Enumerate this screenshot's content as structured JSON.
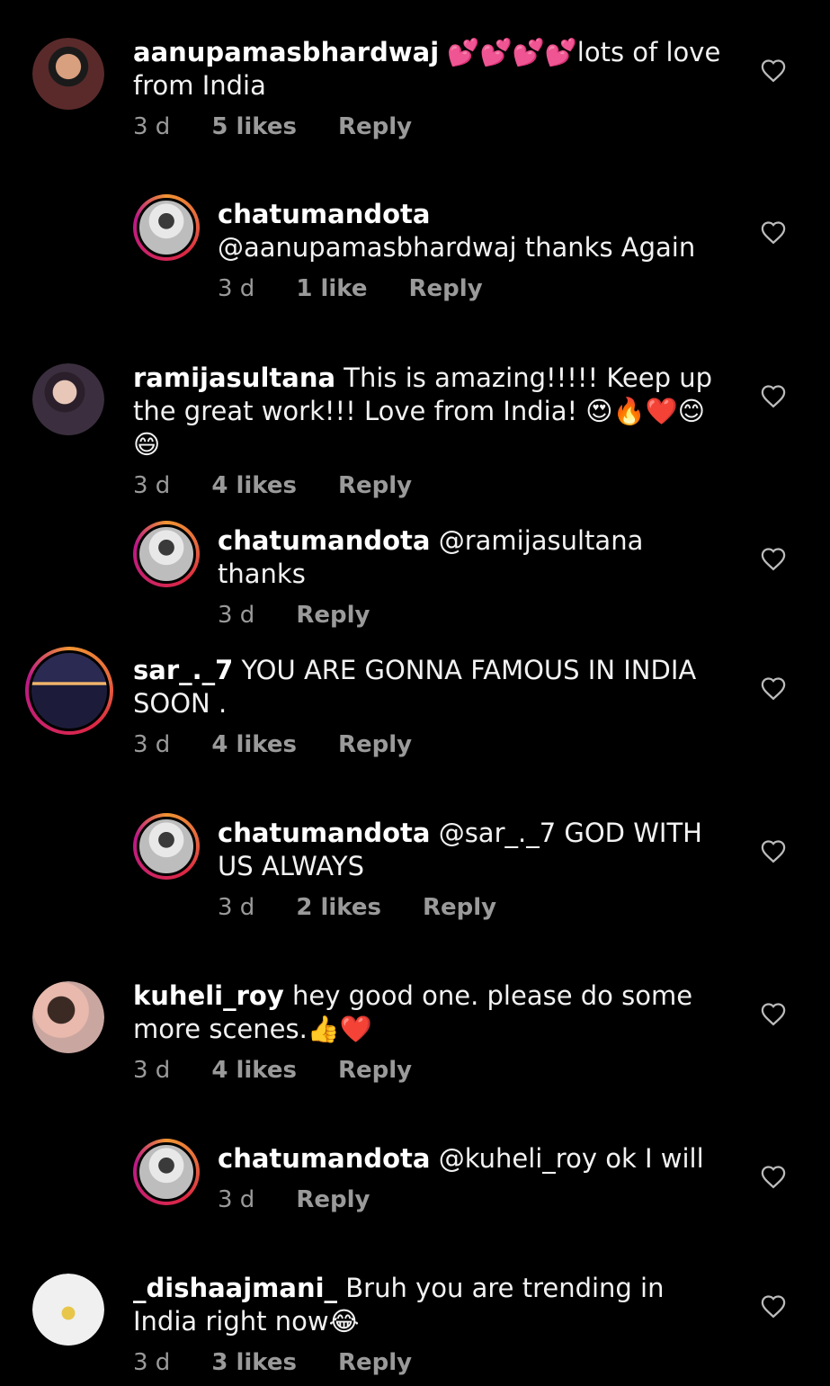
{
  "comments": [
    {
      "username": "aanupamasbhardwaj",
      "text": "💕💕💕💕lots of love from India",
      "time": "3 d",
      "likes": "5 likes",
      "reply": "Reply",
      "is_reply": false,
      "avatar": {
        "bg": "#5a2a2a",
        "accent": "#d9a080",
        "ring": false
      }
    },
    {
      "username": "chatumandota",
      "text": "@aanupamasbhardwaj thanks Again",
      "time": "3 d",
      "likes": "1 like",
      "reply": "Reply",
      "is_reply": true,
      "avatar": {
        "bg": "#dcdcdc",
        "accent": "#3a3a3a",
        "ring": true
      }
    },
    {
      "username": "ramijasultana",
      "text": "This is amazing!!!!! Keep up the great work!!! Love from India! 😍🔥❤️😊😄",
      "time": "3 d",
      "likes": "4 likes",
      "reply": "Reply",
      "is_reply": false,
      "avatar": {
        "bg": "#3b2f3f",
        "accent": "#e8c7b8",
        "ring": false
      }
    },
    {
      "username": "chatumandota",
      "text": "@ramijasultana thanks",
      "time": "3 d",
      "likes": "",
      "reply": "Reply",
      "is_reply": true,
      "avatar": {
        "bg": "#dcdcdc",
        "accent": "#3a3a3a",
        "ring": true
      }
    },
    {
      "username": "sar_._7",
      "text": "YOU ARE GONNA FAMOUS IN INDIA SOON .",
      "time": "3 d",
      "likes": "4 likes",
      "reply": "Reply",
      "is_reply": false,
      "avatar": {
        "bg": "#1c1c3a",
        "accent": "#f2b66b",
        "ring": true
      }
    },
    {
      "username": "chatumandota",
      "text": "@sar_._7 GOD WITH US ALWAYS",
      "time": "3 d",
      "likes": "2 likes",
      "reply": "Reply",
      "is_reply": true,
      "avatar": {
        "bg": "#dcdcdc",
        "accent": "#3a3a3a",
        "ring": true
      }
    },
    {
      "username": "kuheli_roy",
      "text": "hey good one. please do some more scenes.👍❤️",
      "time": "3 d",
      "likes": "4 likes",
      "reply": "Reply",
      "is_reply": false,
      "avatar": {
        "bg": "#c9a6a0",
        "accent": "#3b2a24",
        "ring": false
      }
    },
    {
      "username": "chatumandota",
      "text": "@kuheli_roy ok I will",
      "time": "3 d",
      "likes": "",
      "reply": "Reply",
      "is_reply": true,
      "avatar": {
        "bg": "#dcdcdc",
        "accent": "#3a3a3a",
        "ring": true
      }
    },
    {
      "username": "_dishaajmani_",
      "text": "Bruh you are trending in India right now😂",
      "time": "3 d",
      "likes": "3 likes",
      "reply": "Reply",
      "is_reply": false,
      "avatar": {
        "bg": "#f0f0f0",
        "accent": "#e7c64a",
        "ring": false
      }
    }
  ],
  "icons": {
    "like": "heart-outline-icon"
  },
  "colors": {
    "background": "#000000",
    "meta": "#9a9a9a",
    "text": "#f2f2f2"
  }
}
